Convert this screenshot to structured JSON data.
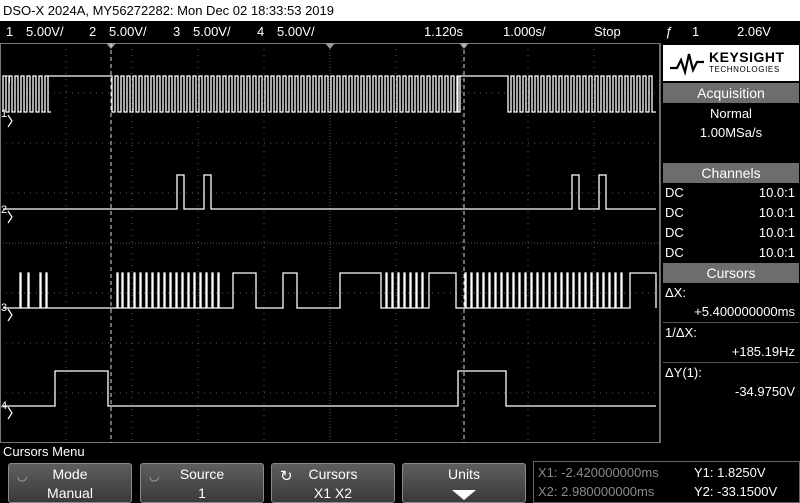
{
  "title_bar": "DSO-X 2024A, MY56272282: Mon Dec 02 18:33:53 2019",
  "status_bar": {
    "ch1_num": "1",
    "ch1_scale": "5.00V/",
    "ch2_num": "2",
    "ch2_scale": "5.00V/",
    "ch3_num": "3",
    "ch3_scale": "5.00V/",
    "ch4_num": "4",
    "ch4_scale": "5.00V/",
    "time_delay": "1.120s",
    "time_scale": "1.000s/",
    "run_state": "Stop",
    "trigger_symbol": "ƒ",
    "trigger_channel": "1",
    "trigger_level": "2.06V"
  },
  "brand": {
    "name": "KEYSIGHT",
    "subtitle": "TECHNOLOGIES"
  },
  "acquisition": {
    "header": "Acquisition",
    "mode": "Normal",
    "rate": "1.00MSa/s"
  },
  "channels": {
    "header": "Channels",
    "rows": [
      {
        "coupling": "DC",
        "probe": "10.0:1"
      },
      {
        "coupling": "DC",
        "probe": "10.0:1"
      },
      {
        "coupling": "DC",
        "probe": "10.0:1"
      },
      {
        "coupling": "DC",
        "probe": "10.0:1"
      }
    ]
  },
  "cursors_panel": {
    "header": "Cursors",
    "dx_label": "ΔX:",
    "dx_value": "+5.400000000ms",
    "inv_dx_label": "1/ΔX:",
    "inv_dx_value": "+185.19Hz",
    "dy_label": "ΔY(1):",
    "dy_value": "-34.9750V"
  },
  "menu_title": "Cursors Menu",
  "softkeys": {
    "mode": {
      "line1": "Mode",
      "line2": "Manual"
    },
    "source": {
      "line1": "Source",
      "line2": "1"
    },
    "cursors": {
      "line1": "Cursors",
      "line2": "X1 X2"
    },
    "units": {
      "line1": "Units"
    }
  },
  "readouts": {
    "x1": "X1: -2.420000000ms",
    "x2": "X2: 2.980000000ms",
    "y1": "Y1: 1.8250V",
    "y2": "Y2: -33.1500V"
  },
  "markers": {
    "ch1": "1",
    "ch2": "2",
    "ch3": "3",
    "ch4": "4",
    "trigger": "T"
  },
  "colors": {
    "trace": "#ffffff",
    "grid": "#5a5a5a",
    "panel_header": "#6d6d6d"
  }
}
